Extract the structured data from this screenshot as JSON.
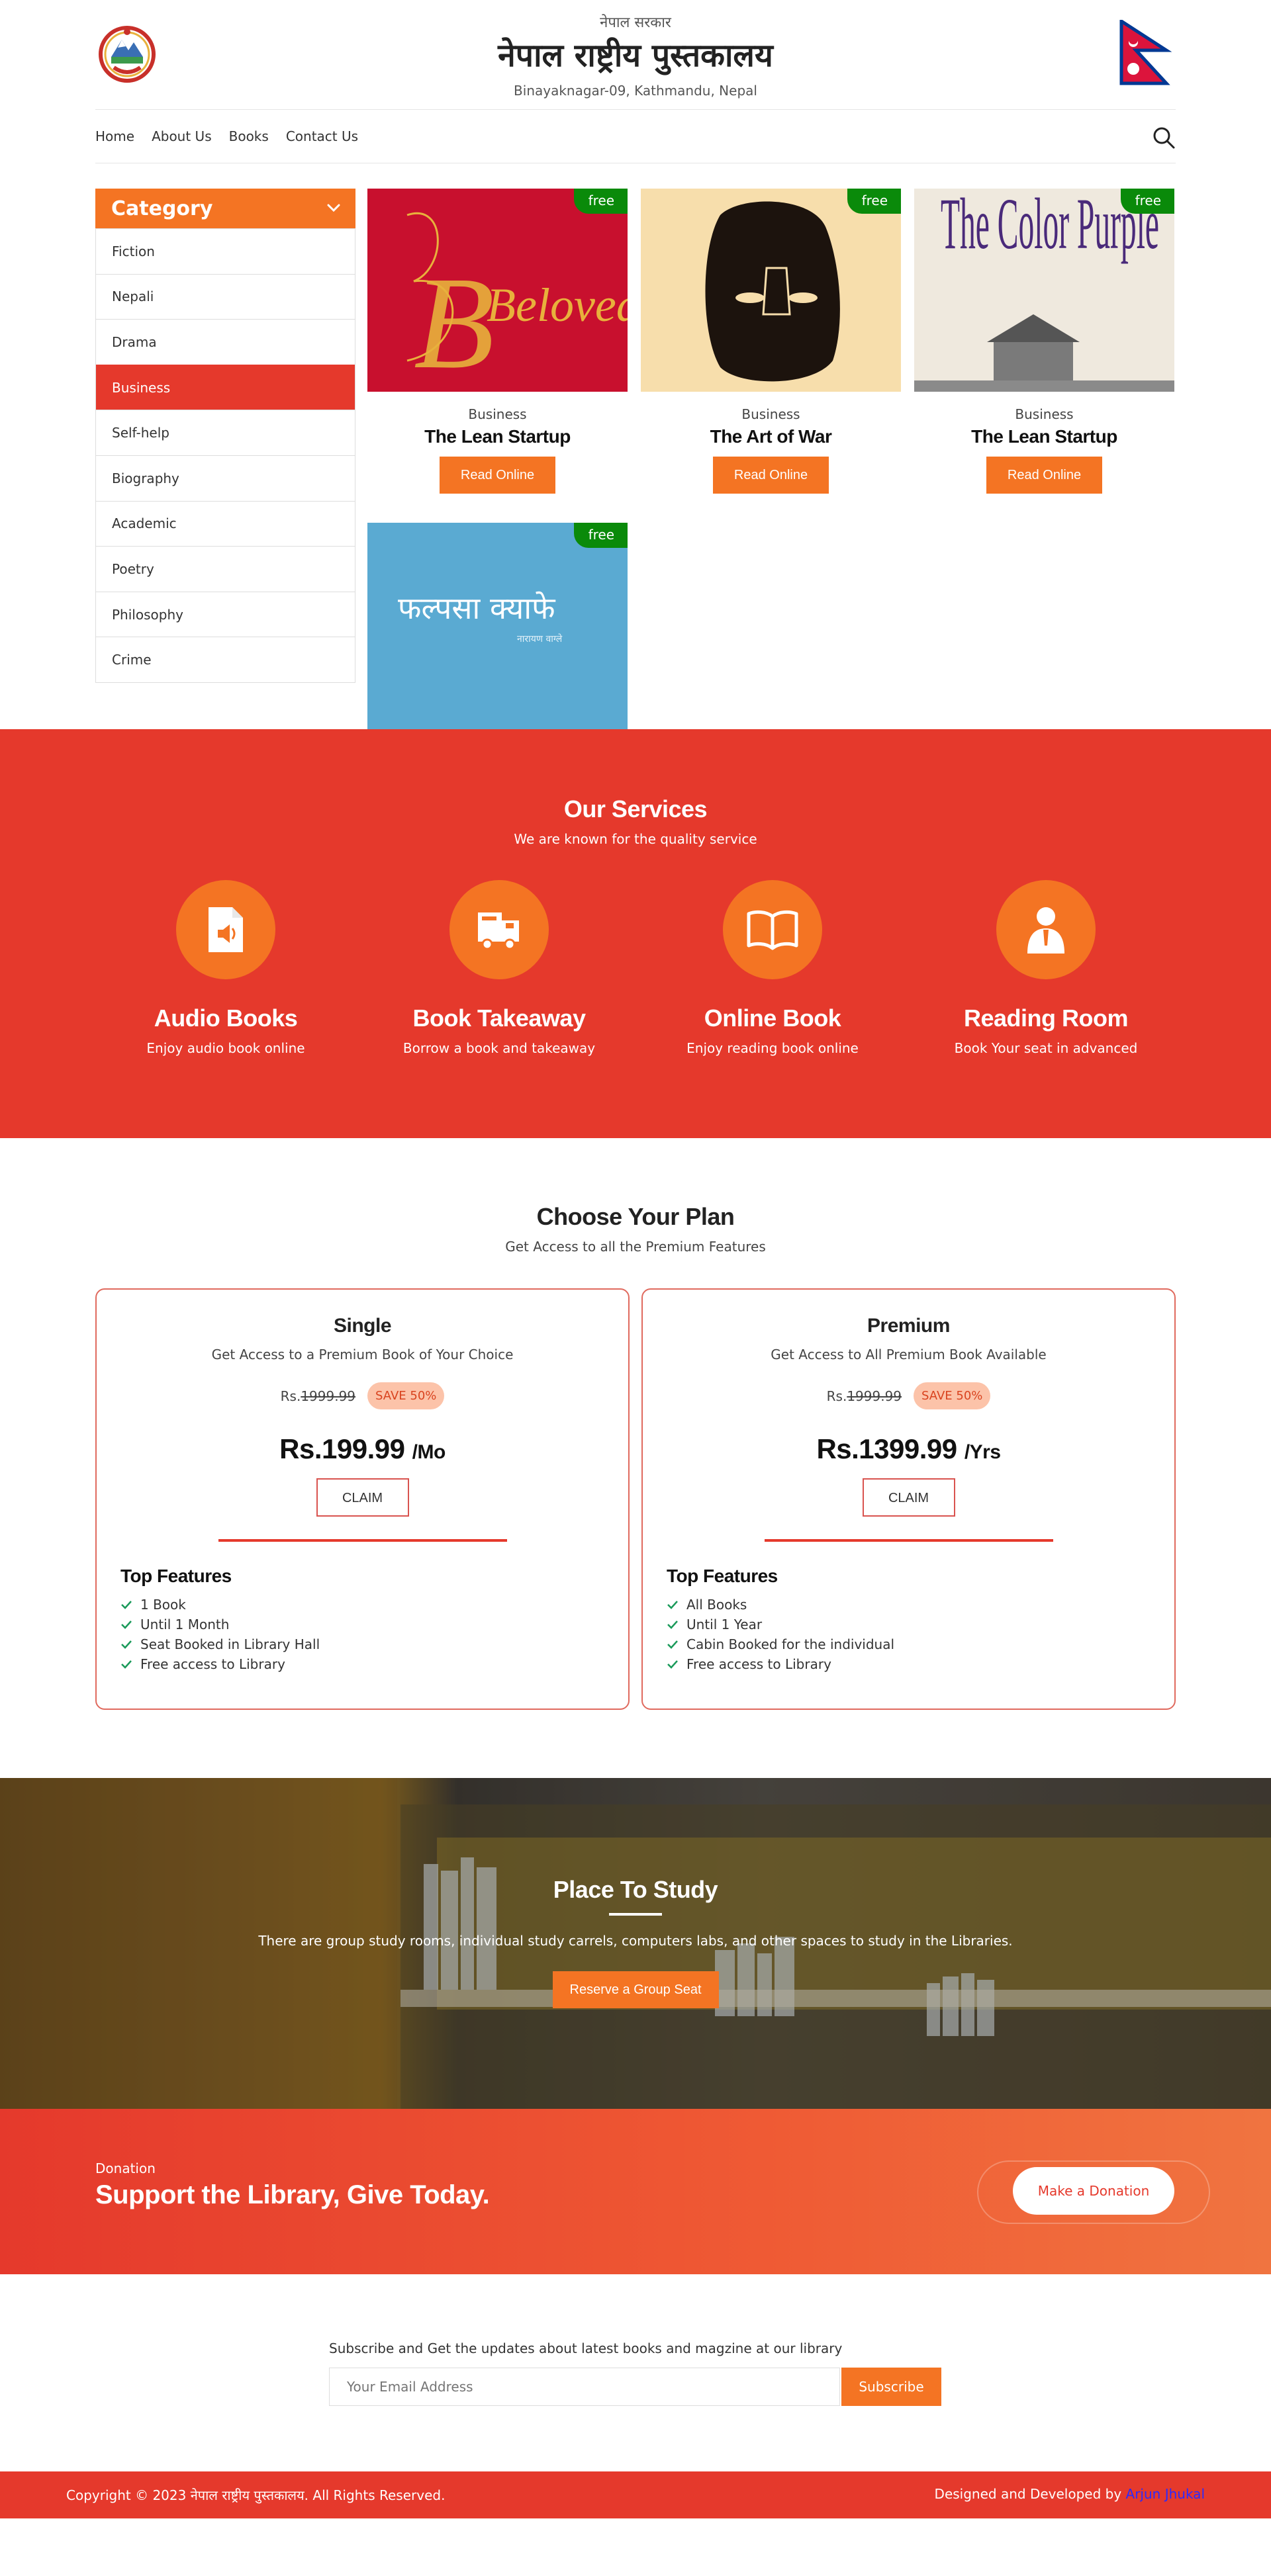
{
  "header": {
    "gov_label": "नेपाल सरकार",
    "library_name": "नेपाल राष्ट्रीय पुस्तकालय",
    "address": "Binayaknagar-09, Kathmandu, Nepal"
  },
  "nav": {
    "items": [
      "Home",
      "About Us",
      "Books",
      "Contact Us"
    ]
  },
  "sidebar": {
    "heading": "Category",
    "items": [
      "Fiction",
      "Nepali",
      "Drama",
      "Business",
      "Self-help",
      "Biography",
      "Academic",
      "Poetry",
      "Philosophy",
      "Crime"
    ],
    "active": "Business"
  },
  "books": [
    {
      "badge": "free",
      "cover_text": "Beloved",
      "category": "Business",
      "title": "The Lean Startup",
      "button": "Read Online"
    },
    {
      "badge": "free",
      "category": "Business",
      "title": "The Art of War",
      "button": "Read Online"
    },
    {
      "badge": "free",
      "cover_text": "The Color Purple",
      "category": "Business",
      "title": "The Lean Startup",
      "button": "Read Online"
    },
    {
      "badge": "free",
      "cover_text": "फल्पसा क्याफे",
      "cover_author": "नारायण वाग्ले"
    }
  ],
  "services": {
    "title": "Our Services",
    "subtitle": "We are known for the quality service",
    "items": [
      {
        "icon": "audio-file-icon",
        "name": "Audio Books",
        "desc": "Enjoy audio book online"
      },
      {
        "icon": "delivery-truck-icon",
        "name": "Book Takeaway",
        "desc": "Borrow a book and takeaway"
      },
      {
        "icon": "open-book-icon",
        "name": "Online Book",
        "desc": "Enjoy reading book online"
      },
      {
        "icon": "reader-person-icon",
        "name": "Reading Room",
        "desc": "Book Your seat in advanced"
      }
    ]
  },
  "plans": {
    "title": "Choose Your Plan",
    "subtitle": "Get Access to all the Premium Features",
    "features_heading": "Top Features",
    "items": [
      {
        "name": "Single",
        "desc": "Get Access to a Premium Book of Your Choice",
        "old_prefix": "Rs.",
        "old_price": "1999.99",
        "save": "SAVE 50%",
        "price": "Rs.199.99",
        "period": "/Mo",
        "button": "CLAIM",
        "features": [
          "1 Book",
          "Until 1 Month",
          "Seat Booked in Library Hall",
          "Free access to Library"
        ]
      },
      {
        "name": "Premium",
        "desc": "Get Access to All Premium Book Available",
        "old_prefix": "Rs.",
        "old_price": "1999.99",
        "save": "SAVE 50%",
        "price": "Rs.1399.99",
        "period": "/Yrs",
        "button": "CLAIM",
        "features": [
          "All Books",
          "Until 1 Year",
          "Cabin Booked for the individual",
          "Free access to Library"
        ]
      }
    ]
  },
  "study": {
    "title": "Place To Study",
    "text": "There are group study rooms, individual study carrels, computers labs, and other spaces to study in the Libraries.",
    "button": "Reserve a Group Seat"
  },
  "donation": {
    "label": "Donation",
    "headline": "Support the Library, Give Today.",
    "button": "Make a Donation"
  },
  "subscribe": {
    "text": "Subscribe and Get the updates about latest books and magzine at our library",
    "placeholder": "Your Email Address",
    "button": "Subscribe"
  },
  "footer": {
    "copyright": "Copyright © 2023 नेपाल राष्ट्रीय पुस्तकालय. All Rights Reserved.",
    "credit_prefix": "Designed and Developed by",
    "credit_name": "Arjun Jhukal"
  },
  "colors": {
    "primary_red": "#e5392c",
    "accent_orange": "#f47423",
    "badge_green": "#0a8a0a"
  }
}
